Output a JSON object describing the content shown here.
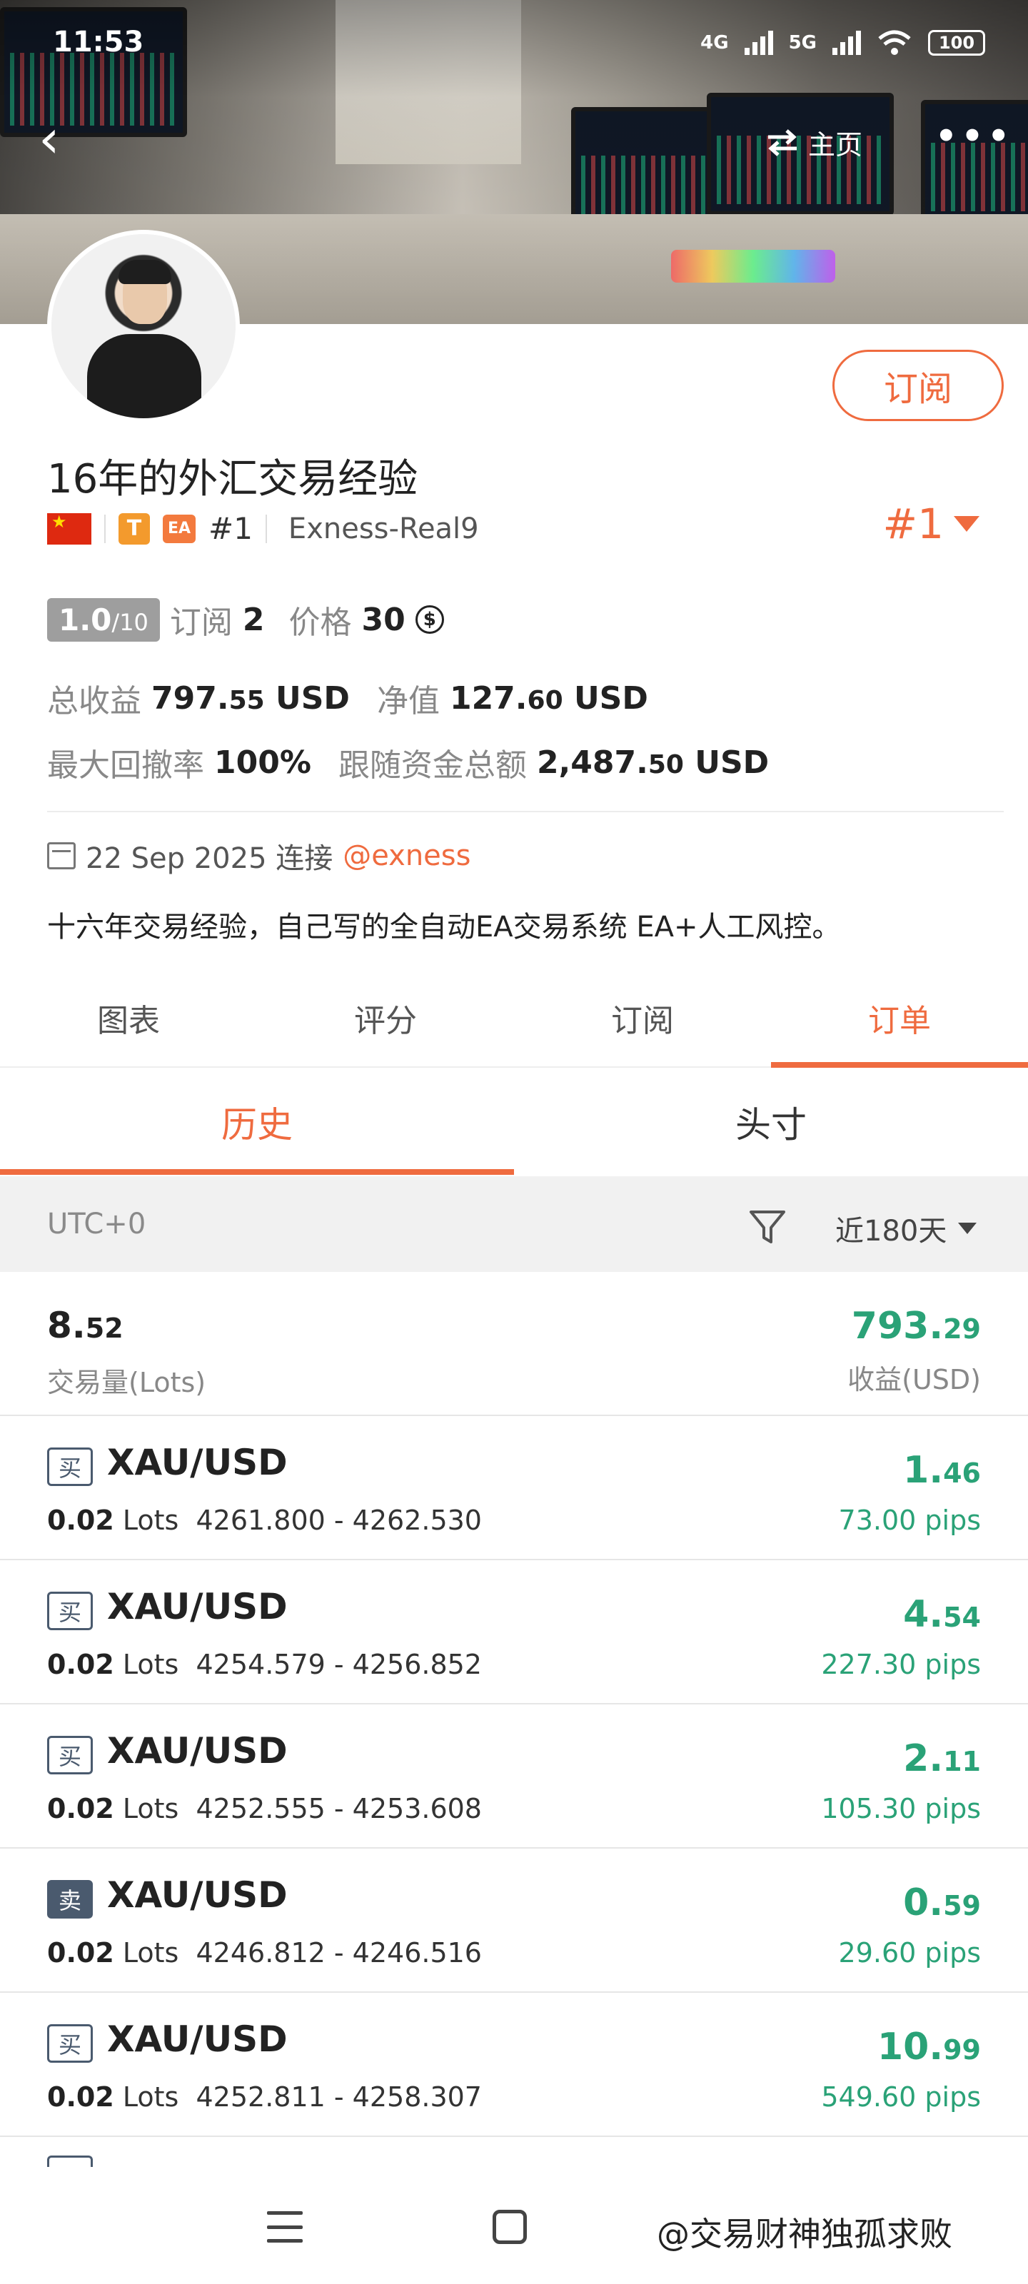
{
  "status_bar": {
    "time": "11:53",
    "net1": "4G",
    "net2": "5G",
    "battery": "100"
  },
  "header": {
    "home_label": "主页",
    "more_label": "•••"
  },
  "profile": {
    "subscribe_label": "订阅",
    "title": "16年的外汇交易经验",
    "badge_t": "T",
    "badge_ea": "EA",
    "rank": "#1",
    "server": "Exness-Real9",
    "rank_right": "#1",
    "rating": "1.0",
    "rating_max": "/10",
    "subscribers_label": "订阅",
    "subscribers": "2",
    "price_label": "价格",
    "price": "30",
    "total_profit_label": "总收益",
    "total_profit_int": "797.",
    "total_profit_dec": "55",
    "total_profit_ccy": "USD",
    "equity_label": "净值",
    "equity_int": "127.",
    "equity_dec": "60",
    "equity_ccy": "USD",
    "max_dd_label": "最大回撤率",
    "max_dd": "100%",
    "follow_funds_label": "跟随资金总额",
    "follow_funds_int": "2,487.",
    "follow_funds_dec": "50",
    "follow_funds_ccy": "USD",
    "connected_date": "22 Sep 2025 连接",
    "broker_link": "@exness",
    "bio": "十六年交易经验，自己写的全自动EA交易系统 EA+人工风控。"
  },
  "tabs": [
    "图表",
    "评分",
    "订阅",
    "订单"
  ],
  "subtabs": [
    "历史",
    "头寸"
  ],
  "filter": {
    "timezone": "UTC+0",
    "period": "近180天"
  },
  "summary": {
    "volume_int": "8.",
    "volume_dec": "52",
    "volume_label": "交易量(Lots)",
    "profit_int": "793.",
    "profit_dec": "29",
    "profit_label": "收益(USD)"
  },
  "orders": [
    {
      "side": "买",
      "symbol": "XAU/USD",
      "lots": "0.02",
      "lots_unit": "Lots",
      "prices": "4261.800 - 4262.530",
      "pl_int": "1.",
      "pl_dec": "46",
      "pips": "73.00 pips"
    },
    {
      "side": "买",
      "symbol": "XAU/USD",
      "lots": "0.02",
      "lots_unit": "Lots",
      "prices": "4254.579 - 4256.852",
      "pl_int": "4.",
      "pl_dec": "54",
      "pips": "227.30 pips"
    },
    {
      "side": "买",
      "symbol": "XAU/USD",
      "lots": "0.02",
      "lots_unit": "Lots",
      "prices": "4252.555 - 4253.608",
      "pl_int": "2.",
      "pl_dec": "11",
      "pips": "105.30 pips"
    },
    {
      "side": "卖",
      "symbol": "XAU/USD",
      "lots": "0.02",
      "lots_unit": "Lots",
      "prices": "4246.812 - 4246.516",
      "pl_int": "0.",
      "pl_dec": "59",
      "pips": "29.60 pips"
    },
    {
      "side": "买",
      "symbol": "XAU/USD",
      "lots": "0.02",
      "lots_unit": "Lots",
      "prices": "4252.811 - 4258.307",
      "pl_int": "10.",
      "pl_dec": "99",
      "pips": "549.60 pips"
    }
  ],
  "watermark": "@交易财神独孤求败",
  "colors": {
    "accent": "#ef6b3f",
    "profit": "#2aa277",
    "tag": "#4a5a6e"
  }
}
